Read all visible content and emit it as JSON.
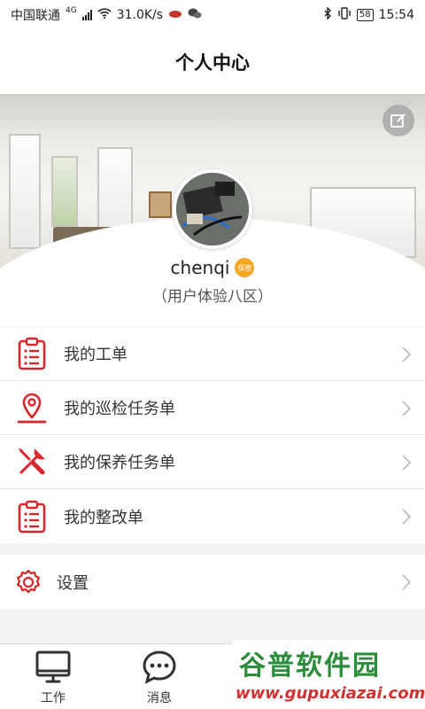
{
  "status_bar": {
    "carrier": "中国联通",
    "network": "4G",
    "speed": "31.0K/s",
    "battery": "58",
    "time": "15:54"
  },
  "header": {
    "title": "个人中心"
  },
  "profile": {
    "username": "chenqi",
    "badge": "保密",
    "org": "（用户体验八区）"
  },
  "menu": {
    "items": [
      {
        "label": "我的工单",
        "icon": "clipboard-list-icon"
      },
      {
        "label": "我的巡检任务单",
        "icon": "location-pin-icon"
      },
      {
        "label": "我的保养任务单",
        "icon": "wrench-screwdriver-icon"
      },
      {
        "label": "我的整改单",
        "icon": "clipboard-list-icon"
      }
    ],
    "settings_label": "设置"
  },
  "tabbar": {
    "tabs": [
      {
        "label": "工作",
        "icon": "monitor-icon"
      },
      {
        "label": "消息",
        "icon": "chat-bubble-icon"
      }
    ]
  },
  "watermark": {
    "cn": "谷普软件园",
    "en": "www.gupuxiazai.com"
  },
  "colors": {
    "accent": "#d9262c",
    "badge": "#f5a623"
  }
}
